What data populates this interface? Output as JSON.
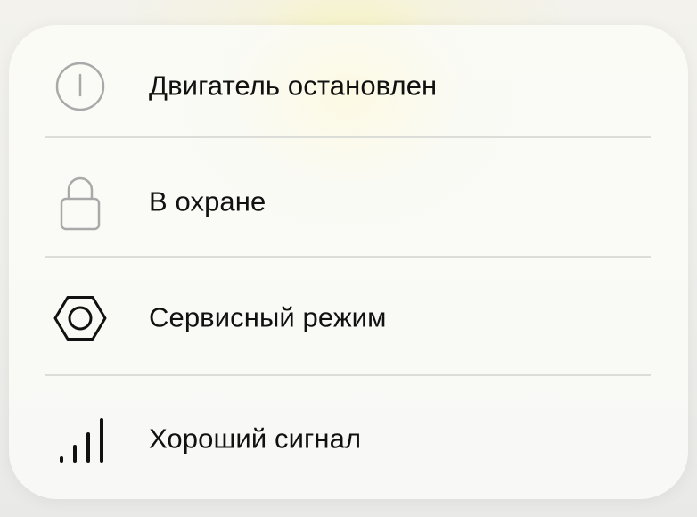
{
  "status_list": {
    "items": [
      {
        "id": "engine",
        "icon": "power-icon",
        "label": "Двигатель остановлен"
      },
      {
        "id": "security",
        "icon": "padlock-icon",
        "label": "В охране"
      },
      {
        "id": "service",
        "icon": "hex-nut-icon",
        "label": "Сервисный режим"
      },
      {
        "id": "signal",
        "icon": "signal-bars-icon",
        "label": "Хороший сигнал"
      }
    ]
  },
  "colors": {
    "icon_muted": "#a9a9a9",
    "icon_active": "#111111",
    "text": "#111111",
    "divider": "#dcdcd8",
    "card_background": "#f9f9f6"
  }
}
